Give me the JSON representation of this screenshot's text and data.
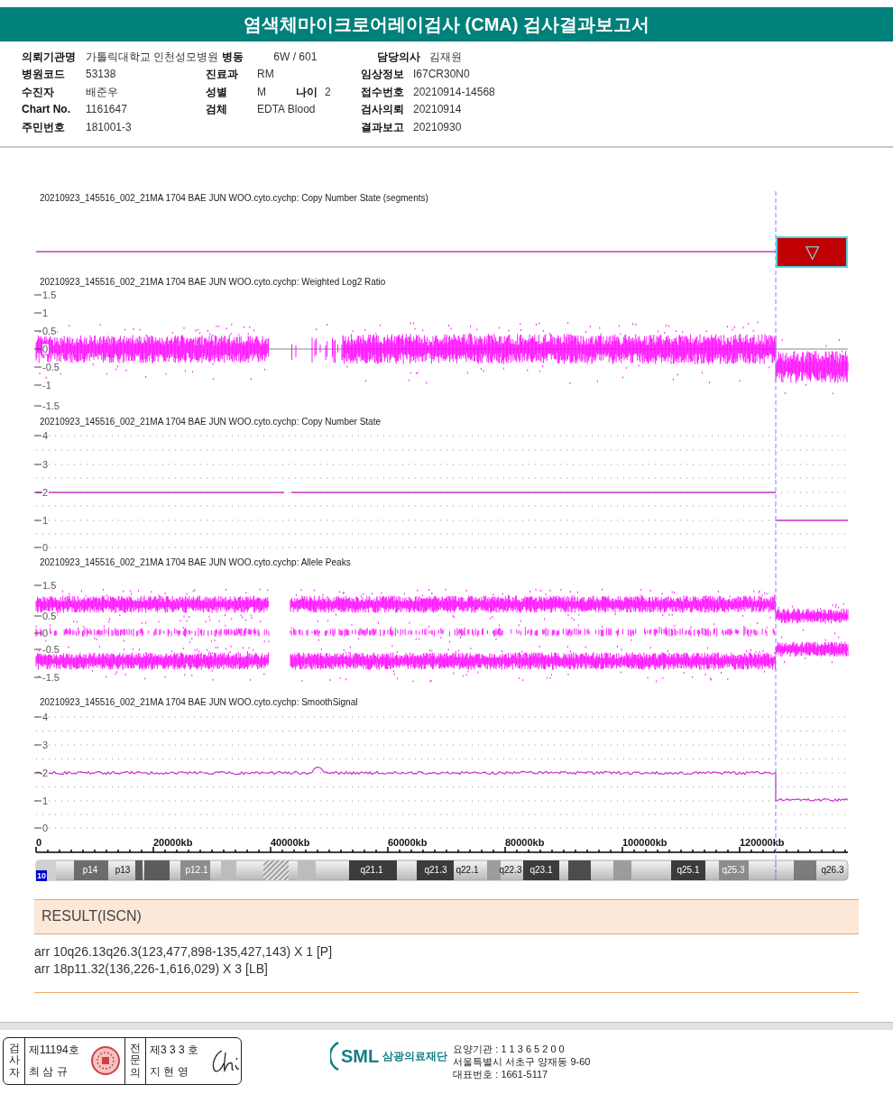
{
  "title": "염색체마이크로어레이검사 (CMA) 검사결과보고서",
  "patient_info": [
    {
      "left": {
        "label": "의뢰기관명",
        "value": "가톨릭대학교 인천성모병원"
      },
      "middle": {
        "label": "병동",
        "value": "6W / 601"
      },
      "right": {
        "label": "담당의사",
        "value": "김재원"
      }
    },
    {
      "left": {
        "label": "병원코드",
        "value": "53138"
      },
      "middle": {
        "label": "진료과",
        "value": "RM"
      },
      "right": {
        "label": "임상정보",
        "value": "I67CR30N0"
      }
    },
    {
      "left": {
        "label": "수진자",
        "value": "배준우"
      },
      "middle": {
        "label": "성별",
        "value": "M"
      },
      "extra": {
        "label": "나이",
        "value": "2"
      },
      "right": {
        "label": "접수번호",
        "value": "20210914-14568"
      }
    },
    {
      "left": {
        "label": "Chart No.",
        "value": "1161647"
      },
      "middle": {
        "label": "검체",
        "value": "EDTA Blood"
      },
      "right": {
        "label": "검사의뢰",
        "value": "20210914"
      }
    },
    {
      "left": {
        "label": "주민번호",
        "value": "181001-3"
      },
      "right": {
        "label": "결과보고",
        "value": "20210930"
      }
    }
  ],
  "tracks": [
    {
      "kind": "segments",
      "title": "20210923_145516_002_21MA 1704 BAE JUN WOO.cyto.cychp: Copy Number State (segments)",
      "marker": "▽"
    },
    {
      "kind": "log2",
      "title": "20210923_145516_002_21MA 1704 BAE JUN WOO.cyto.cychp: Weighted Log2 Ratio",
      "ticks": [
        "1.5",
        "1",
        "0.5",
        "0",
        "-0.5",
        "-1",
        "-1.5"
      ]
    },
    {
      "kind": "copy_number",
      "title": "20210923_145516_002_21MA 1704 BAE JUN WOO.cyto.cychp: Copy Number State",
      "ticks": [
        "4",
        "3",
        "2",
        "1",
        "0"
      ]
    },
    {
      "kind": "allele",
      "title": "20210923_145516_002_21MA 1704 BAE JUN WOO.cyto.cychp: Allele Peaks",
      "ticks": [
        "1.5",
        "0.5",
        "0",
        "-0.5",
        "-1.5"
      ]
    },
    {
      "kind": "smooth",
      "title": "20210923_145516_002_21MA 1704 BAE JUN WOO.cyto.cychp: SmoothSignal",
      "ticks": [
        "4",
        "3",
        "2",
        "1",
        "0"
      ]
    }
  ],
  "x_axis": {
    "labels": [
      "0",
      "20000kb",
      "40000kb",
      "60000kb",
      "80000kb",
      "100000kb",
      "120000kb"
    ]
  },
  "ideogram": {
    "chromosome": "10",
    "bands": [
      "p14",
      "p13",
      "p12.1",
      "q21.1",
      "q21.3",
      "q22.1",
      "q22.3",
      "q23.1",
      "q25.1",
      "q25.3",
      "q26.3"
    ]
  },
  "result": {
    "heading": "RESULT(ISCN)",
    "lines": [
      "arr 10q26.13q26.3(123,477,898-135,427,143) X 1 [P]",
      "arr 18p11.32(136,226-1,616,029) X 3 [LB]"
    ]
  },
  "footer": {
    "signatures": [
      {
        "role": "검사자",
        "number": "제11194호",
        "name": "최 삼 규"
      },
      {
        "role": "전문의",
        "number": "제3 3 3 호",
        "name": "지 현 영"
      }
    ],
    "logo": "SML",
    "organization": "삼광의료재단",
    "address_lines": [
      "요양기관 : 1 1 3 6 5 2 0 0",
      "서울특별시 서초구 양재동 9-60",
      "대표번호 : 1661-5117"
    ]
  }
}
